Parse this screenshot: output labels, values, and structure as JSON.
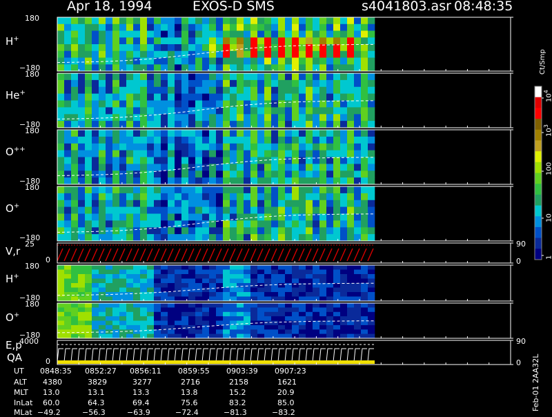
{
  "header": {
    "date": "Apr 18, 1994",
    "instrument": "EXOS-D SMS",
    "file": "s4041803.asr",
    "time": "08:48:35"
  },
  "colorbar": {
    "unit_label": "Ct/Smp",
    "ticks": [
      "1",
      "10",
      "100",
      "10",
      "10"
    ],
    "tick_exponents": [
      "",
      "",
      "",
      "3",
      "4"
    ],
    "colors": [
      "#000080",
      "#0a2a9a",
      "#0050c8",
      "#0090e0",
      "#00c8d0",
      "#20a060",
      "#30c040",
      "#60d020",
      "#a0e000",
      "#e0f000",
      "#c0a020",
      "#a08000",
      "#806000",
      "#ff0000",
      "#e00000",
      "#ffffff"
    ]
  },
  "panels": [
    {
      "label": "H",
      "charge": "+",
      "ymax": "180",
      "ymin": "−180"
    },
    {
      "label": "He",
      "charge": "+",
      "ymax": "180",
      "ymin": "−180"
    },
    {
      "label": "O",
      "charge": "++",
      "ymax": "180",
      "ymin": "−180"
    },
    {
      "label": "O",
      "charge": "+",
      "ymax": "180",
      "ymin": "−180"
    },
    {
      "label": "V,r",
      "charge": "",
      "ymax": "25",
      "ymin": "0",
      "right_max": "90",
      "right_min": "0"
    },
    {
      "label": "H",
      "charge": "+",
      "ymax": "180",
      "ymin": "−180"
    },
    {
      "label": "O",
      "charge": "+",
      "ymax": "180",
      "ymin": "−180"
    },
    {
      "label": "E,p",
      "charge": "",
      "ymax": "4000",
      "ymin": "0",
      "right_max": "90",
      "right_min": "0"
    }
  ],
  "qa_label": "QA",
  "side_note": "Feb-01 2AA32L",
  "table": {
    "row_labels": [
      "UT",
      "ALT",
      "MLT",
      "InLat",
      "MLat"
    ],
    "columns": [
      [
        "0848:35",
        "4380",
        "13.0",
        "60.0",
        "−49.2"
      ],
      [
        "0852:27",
        "3829",
        "13.1",
        "64.3",
        "−56.3"
      ],
      [
        "0856:11",
        "3277",
        "13.3",
        "69.4",
        "−63.9"
      ],
      [
        "0859:55",
        "2716",
        "13.8",
        "75.6",
        "−72.4"
      ],
      [
        "0903:39",
        "2158",
        "15.2",
        "83.2",
        "−81.3"
      ],
      [
        "0907:23",
        "1621",
        "20.9",
        "85.0",
        "−83.2"
      ]
    ]
  },
  "chart_data": {
    "type": "heatmap",
    "title": "Apr 18, 1994    EXOS-D SMS",
    "x_label": "UT",
    "x_ticks": [
      "0848:35",
      "0852:27",
      "0856:11",
      "0859:55",
      "0903:39",
      "0907:23"
    ],
    "panels": [
      "H+",
      "He+",
      "O++",
      "O+",
      "V,r",
      "H+",
      "O+",
      "E,p"
    ],
    "y_range_pitch": [
      -180,
      180
    ],
    "colorbar_range_counts": [
      1,
      10000
    ],
    "colorbar_scale": "log",
    "colorbar_label": "Ct/Smp",
    "grid": false
  }
}
